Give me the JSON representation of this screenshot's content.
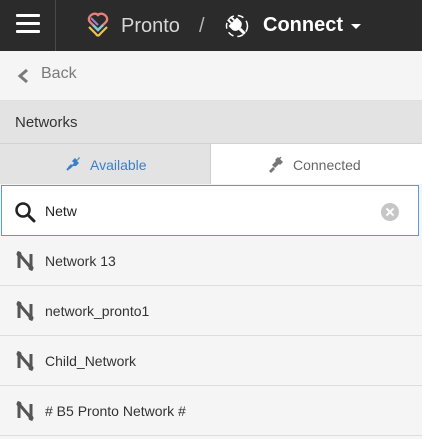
{
  "header": {
    "app_name": "Pronto",
    "separator": "/",
    "current_section": "Connect",
    "icons": {
      "menu": "hamburger-icon",
      "logo": "pronto-logo",
      "section": "plug-icon",
      "dropdown": "caret-down-icon"
    }
  },
  "back": {
    "label": "Back",
    "icon": "chevron-left-icon"
  },
  "section": {
    "title": "Networks"
  },
  "tabs": [
    {
      "label": "Available",
      "icon": "plug-connect-icon",
      "active": true,
      "color": "#3d7fc4"
    },
    {
      "label": "Connected",
      "icon": "plug-icon",
      "active": false
    }
  ],
  "search": {
    "value": "Netw",
    "icon": "search-icon",
    "clear_icon": "clear-icon"
  },
  "networks": [
    {
      "label": "Network 13",
      "icon": "network-icon"
    },
    {
      "label": "network_pronto1",
      "icon": "network-icon"
    },
    {
      "label": "Child_Network",
      "icon": "network-icon"
    },
    {
      "label": "# B5 Pronto Network #",
      "icon": "network-icon"
    }
  ],
  "colors": {
    "topbar": "#2b2b2b",
    "accent": "#3d7fc4",
    "search_border": "#5b9bd5"
  }
}
